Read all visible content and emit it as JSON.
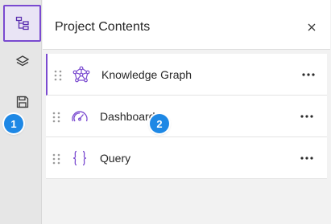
{
  "panel": {
    "title": "Project Contents",
    "close_icon": "close-icon"
  },
  "rail": {
    "items": [
      {
        "icon": "project-contents-icon",
        "active": true
      },
      {
        "icon": "layers-icon",
        "active": false
      },
      {
        "icon": "save-icon",
        "active": false
      }
    ]
  },
  "list": {
    "items": [
      {
        "label": "Knowledge Graph",
        "icon": "knowledge-graph-icon",
        "selected": true
      },
      {
        "label": "Dashboard",
        "icon": "dashboard-icon",
        "selected": false
      },
      {
        "label": "Query",
        "icon": "query-braces-icon",
        "selected": false
      }
    ]
  },
  "callouts": [
    "1",
    "2"
  ],
  "colors": {
    "accent": "#7a4ad0",
    "callout": "#1e88e5"
  }
}
